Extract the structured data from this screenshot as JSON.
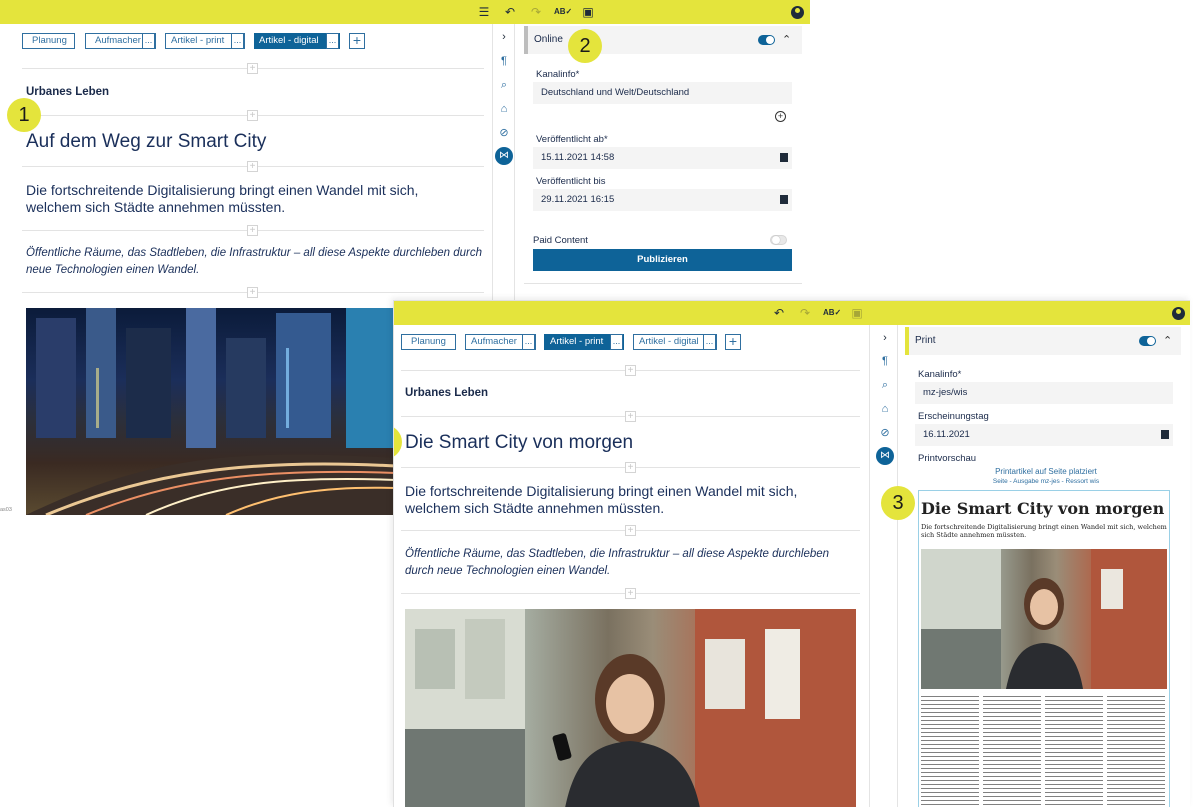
{
  "online_view": {
    "toolbar": {
      "icons": [
        "list-icon",
        "undo-icon",
        "redo-icon",
        "spellcheck-icon",
        "save-icon",
        "user-icon"
      ]
    },
    "tabs": [
      {
        "label": "Planung",
        "active": false,
        "has_more": false
      },
      {
        "label": "Aufmacher",
        "active": false,
        "has_more": true
      },
      {
        "label": "Artikel - print",
        "active": false,
        "has_more": true
      },
      {
        "label": "Artikel - digital",
        "active": true,
        "has_more": true
      }
    ],
    "more_label": "...",
    "add_label": "+",
    "article": {
      "ressort": "Urbanes Leben",
      "headline": "Auf dem Weg zur Smart City",
      "teaser": "Die fortschreitende Digitalisierung bringt einen Wandel mit sich, welchem sich Städte annehmen müssten.",
      "intro": "Öffentliche Räume, das Stadtleben, die Infrastruktur – all diese Aspekte durchleben durch neue Technologien einen Wandel."
    },
    "side_label": "as03",
    "channel_panel": {
      "title": "Online",
      "enabled": true,
      "kanalinfo_label": "Kanalinfo*",
      "kanalinfo_value": "Deutschland und Welt/Deutschland",
      "published_from_label": "Veröffentlicht ab*",
      "published_from_value": "15.11.2021 14:58",
      "published_to_label": "Veröffentlicht bis",
      "published_to_value": "29.11.2021 16:15",
      "paid_label": "Paid Content",
      "paid_enabled": false,
      "publish_button": "Publizieren"
    },
    "badges": [
      "1",
      "2"
    ]
  },
  "print_view": {
    "tabs": [
      {
        "label": "Planung",
        "active": false,
        "has_more": false
      },
      {
        "label": "Aufmacher",
        "active": false,
        "has_more": true
      },
      {
        "label": "Artikel - print",
        "active": true,
        "has_more": true
      },
      {
        "label": "Artikel - digital",
        "active": false,
        "has_more": true
      }
    ],
    "article": {
      "ressort": "Urbanes Leben",
      "headline": "Die Smart City von morgen",
      "teaser": "Die fortschreitende Digitalisierung bringt einen Wandel mit sich, welchem sich Städte annehmen müssten.",
      "intro": "Öffentliche Räume, das Stadtleben, die Infrastruktur – all diese Aspekte durchleben durch neue Technologien einen Wandel."
    },
    "channel_panel": {
      "title": "Print",
      "enabled": true,
      "kanalinfo_label": "Kanalinfo*",
      "kanalinfo_value": "mz-jes/wis",
      "erscheinungstag_label": "Erscheinungstag",
      "erscheinungstag_value": "16.11.2021",
      "printvorschau_label": "Printvorschau",
      "placed_info": "Printartikel auf Seite platziert",
      "page_info": "Seite - Ausgabe mz-jes - Ressort wis",
      "preview_headline": "Die Smart City von morgen",
      "preview_teaser": "Die fortschreitende Digitalisierung bringt einen Wandel mit sich, welchem sich Städte annehmen müssten."
    },
    "badges": [
      "1",
      "3"
    ]
  }
}
